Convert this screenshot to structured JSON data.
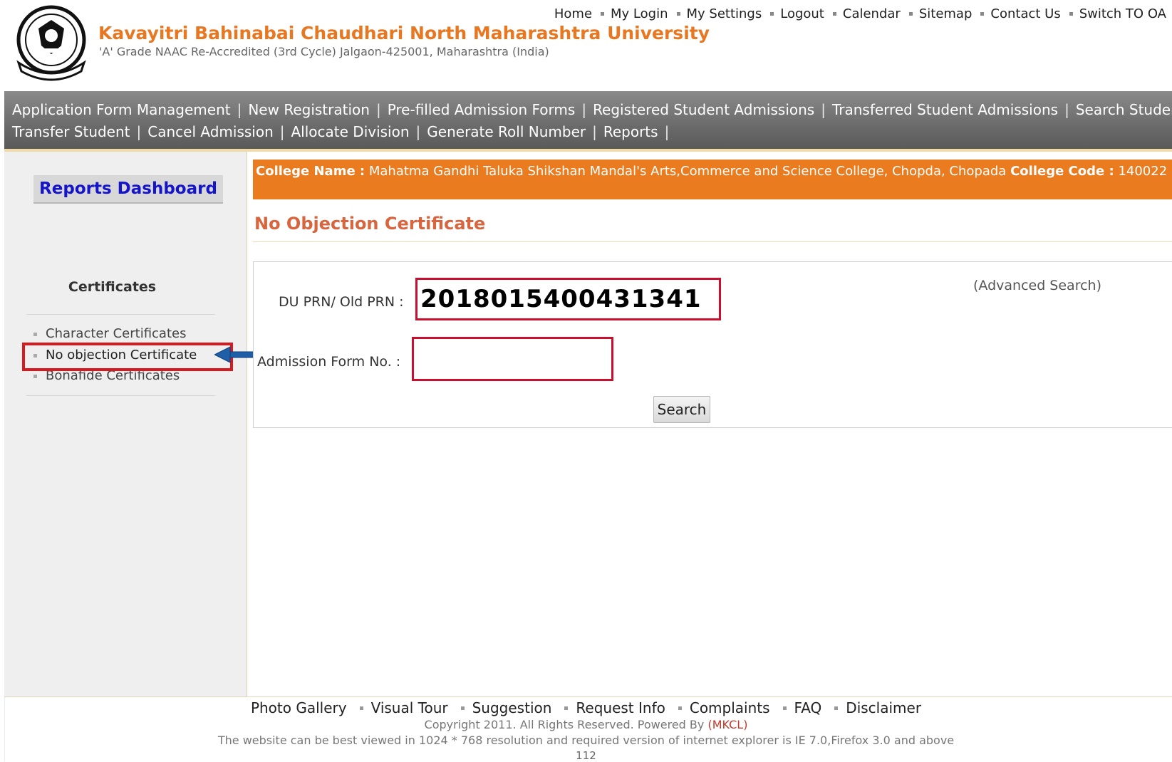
{
  "header": {
    "university_name": "Kavayitri Bahinabai Chaudhari North Maharashtra University",
    "subtitle": "'A' Grade NAAC Re-Accredited (3rd Cycle) Jalgaon-425001, Maharashtra (India)",
    "top_links": [
      "Home",
      "My Login",
      "My Settings",
      "Logout",
      "Calendar",
      "Sitemap",
      "Contact Us",
      "Switch TO OA"
    ],
    "brand_color": "#e87722"
  },
  "nav": {
    "row1": [
      "Application Form Management",
      "New Registration",
      "Pre-filled Admission Forms",
      "Registered Student Admissions",
      "Transferred Student Admissions",
      "Search Student"
    ],
    "row2": [
      "Transfer Student",
      "Cancel Admission",
      "Allocate Division",
      "Generate Roll Number",
      "Reports"
    ]
  },
  "sidebar": {
    "dashboard_label": "Reports Dashboard",
    "section_heading": "Certificates",
    "items": [
      "Character Certificates",
      "No objection Certificate",
      "Bonafide Certificates"
    ],
    "selected_item": "No objection Certificate",
    "highlight_color": "#d71920",
    "arrow_color": "#1f5fa8"
  },
  "college": {
    "name_label": "College Name :",
    "name": "Mahatma Gandhi Taluka Shikshan Mandal's Arts,Commerce and Science College, Chopda, Chopada",
    "code_label": "College Code :",
    "code": "140022",
    "bar_color": "#ea7b1e"
  },
  "main": {
    "page_title": "No Objection Certificate",
    "advanced_search": "(Advanced Search)",
    "prn_label": "DU PRN/ Old PRN :",
    "prn_value": "2018015400431341",
    "admission_label": "Admission Form No. :",
    "admission_value": "",
    "search_button": "Search"
  },
  "footer": {
    "links": [
      "Photo Gallery",
      "Visual Tour",
      "Suggestion",
      "Request Info",
      "Complaints",
      "FAQ",
      "Disclaimer"
    ],
    "copyright_text": "Copyright 2011. All Rights Reserved. Powered By",
    "powered_by": "(MKCL)",
    "best_viewed": "The website can be best viewed in 1024 * 768 resolution and required version of internet explorer is IE 7.0,Firefox 3.0 and above",
    "page_number": "112"
  }
}
